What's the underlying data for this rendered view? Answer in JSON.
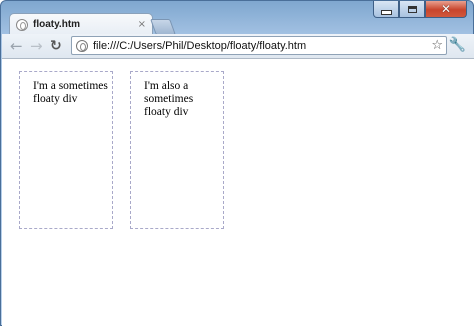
{
  "tab": {
    "title": "floaty.htm",
    "close": "×"
  },
  "toolbar": {
    "back": "←",
    "forward": "→",
    "reload": "↻",
    "url": "file:///C:/Users/Phil/Desktop/floaty/floaty.htm",
    "star": "☆",
    "wrench": "🔧"
  },
  "window_controls": {
    "close": "✕"
  },
  "page": {
    "divs": [
      {
        "text": "I'm a sometimes floaty div"
      },
      {
        "text": "I'm also a sometimes floaty div"
      }
    ]
  },
  "colors": {
    "frame": "#a9c6e6",
    "dashed_border": "#a9a9c9",
    "close_button": "#c8452c"
  }
}
